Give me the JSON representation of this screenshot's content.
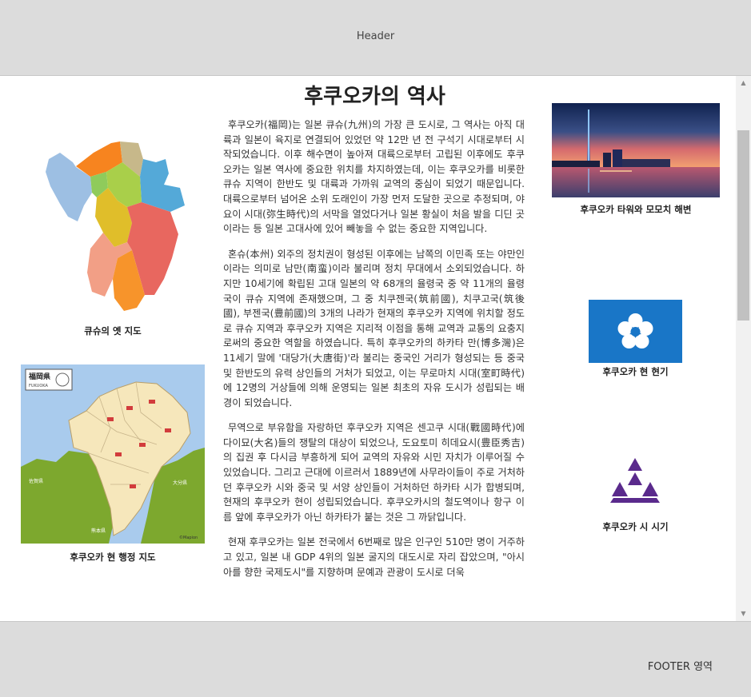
{
  "header": {
    "label": "Header"
  },
  "footer": {
    "label": "FOOTER 영역"
  },
  "page": {
    "title": "후쿠오카의 역사"
  },
  "captions": {
    "old_map": "큐슈의 옛 지도",
    "admin_map": "후쿠오카 현 행정 지도",
    "tower": "후쿠오카 타워와 모모치 해변",
    "prefecture_flag": "후쿠오카 현 현기",
    "city_flag": "후쿠오카 시 시기"
  },
  "map_labels": {
    "admin_title": "福岡県",
    "admin_subtitle": "FUKUOKA",
    "sea_left": "玄界灘",
    "oita": "大分県",
    "saga": "佐賀県",
    "kumamoto": "熊本県",
    "credit": "©Mapion"
  },
  "article": {
    "paragraphs": [
      "후쿠오카(福岡)는 일본 큐슈(九州)의 가장 큰 도시로, 그 역사는 아직 대륙과 일본이 육지로 연결되어 있었던 약 12만 년 전 구석기 시대로부터 시작되었습니다. 이후 해수면이 높아져 대륙으로부터 고립된 이후에도 후쿠오카는 일본 역사에 중요한 위치를 차지하였는데, 이는 후쿠오카를 비롯한 큐슈 지역이 한반도 및 대륙과 가까워 교역의 중심이 되었기 때문입니다. 대륙으로부터 넘어온 소위 도래인이 가장 먼저 도달한 곳으로 추정되며, 야요이 시대(弥生時代)의 서막을 열었다거나 일본 황실이 처음 발을 디딘 곳이라는 등 일본 고대사에 있어 빼놓을 수 없는 중요한 지역입니다.",
      "혼슈(本州) 외주의 정치권이 형성된 이후에는 남쪽의 이민족 또는 야만인이라는 의미로 남만(南蛮)이라 불리며 정치 무대에서 소외되었습니다. 하지만 10세기에 확립된 고대 일본의 약 68개의 율령국 중 약 11개의 율령국이 큐슈 지역에 존재했으며, 그 중 치쿠젠국(筑前國), 치쿠고국(筑後國), 부젠국(豊前國)의 3개의 나라가 현재의 후쿠오카 지역에 위치할 정도로 큐슈 지역과 후쿠오카 지역은 지리적 이점을 통해 교역과 교통의 요충지로써의 중요한 역할을 하였습니다. 특히 후쿠오카의 하카타 만(博多灣)은 11세기 말에 '대당가(大唐街)'라 불리는 중국인 거리가 형성되는 등 중국 및 한반도의 유력 상인들의 거처가 되었고, 이는 무로마치 시대(室町時代)에 12명의 거상들에 의해 운영되는 일본 최초의 자유 도시가 성립되는 배경이 되었습니다.",
      "무역으로 부유함을 자랑하던 후쿠오카 지역은 센고쿠 시대(戰國時代)에 다이묘(大名)들의 쟁탈의 대상이 되었으나, 도요토미 히데요시(豊臣秀吉)의 집권 후 다시금 부흥하게 되어 교역의 자유와 시민 자치가 이루어질 수 있었습니다. 그리고 근대에 이르러서 1889년에 사무라이들이 주로 거처하던 후쿠오카 시와 중국 및 서양 상인들이 거처하던 하카타 시가 합병되며, 현재의 후쿠오카 현이 성립되었습니다. 후쿠오카시의 철도역이나 항구 이름 앞에 후쿠오카가 아닌 하카타가 붙는 것은 그 까닭입니다.",
      "현재 후쿠오카는 일본 전국에서 6번째로 많은 인구인 510만 명이 거주하고 있고, 일본 내 GDP 4위의 일본 굴지의 대도시로 자리 잡았으며, \"아시아를 향한 국제도시\"를 지향하며 문예과 관광이 도시로 더욱"
    ]
  }
}
